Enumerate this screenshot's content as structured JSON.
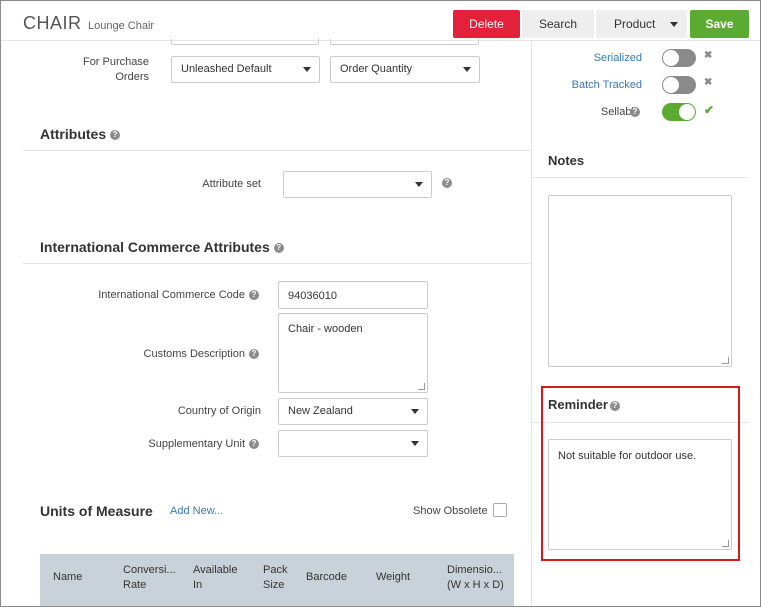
{
  "header": {
    "title": "CHAIR",
    "subtitle": "Lounge Chair",
    "delete_label": "Delete",
    "search_label": "Search",
    "product_label": "Product",
    "save_label": "Save"
  },
  "purchase": {
    "label": "For Purchase Orders",
    "label_line1": "For Purchase",
    "label_line2": "Orders",
    "select1_value": "Unleashed Default",
    "select2_value": "Order Quantity"
  },
  "toggles": [
    {
      "label": "Serialized",
      "state": "off",
      "mark": "✖"
    },
    {
      "label": "Batch Tracked",
      "state": "off",
      "mark": "✖"
    },
    {
      "label": "Sellable",
      "state": "on",
      "mark": "✔"
    }
  ],
  "attributes": {
    "title": "Attributes",
    "attribute_set_label": "Attribute set",
    "attribute_set_value": ""
  },
  "intl": {
    "title": "International Commerce Attributes",
    "code_label": "International Commerce Code",
    "code_value": "94036010",
    "customs_label": "Customs Description",
    "customs_value": "Chair - wooden",
    "country_label": "Country of Origin",
    "country_value": "New Zealand",
    "supp_label": "Supplementary Unit",
    "supp_value": ""
  },
  "notes": {
    "title": "Notes",
    "value": ""
  },
  "reminder": {
    "title": "Reminder",
    "value": "Not suitable for outdoor use."
  },
  "uom": {
    "title": "Units of Measure",
    "add_new_label": "Add New...",
    "show_obsolete_label": "Show Obsolete",
    "columns": [
      {
        "line1": "Name",
        "line2": ""
      },
      {
        "line1": "Conversi...",
        "line2": "Rate"
      },
      {
        "line1": "Available",
        "line2": "In"
      },
      {
        "line1": "Pack",
        "line2": "Size"
      },
      {
        "line1": "Barcode",
        "line2": ""
      },
      {
        "line1": "Weight",
        "line2": ""
      },
      {
        "line1": "Dimensio...",
        "line2": "(W x H x D)"
      }
    ]
  },
  "colors": {
    "delete": "#e4203a",
    "save": "#5bab33",
    "toggle_on": "#5bab33",
    "toggle_off": "#8a8a8a",
    "highlight": "#d51a1a",
    "table_header": "#c9d1da",
    "link": "#3a78b8"
  }
}
